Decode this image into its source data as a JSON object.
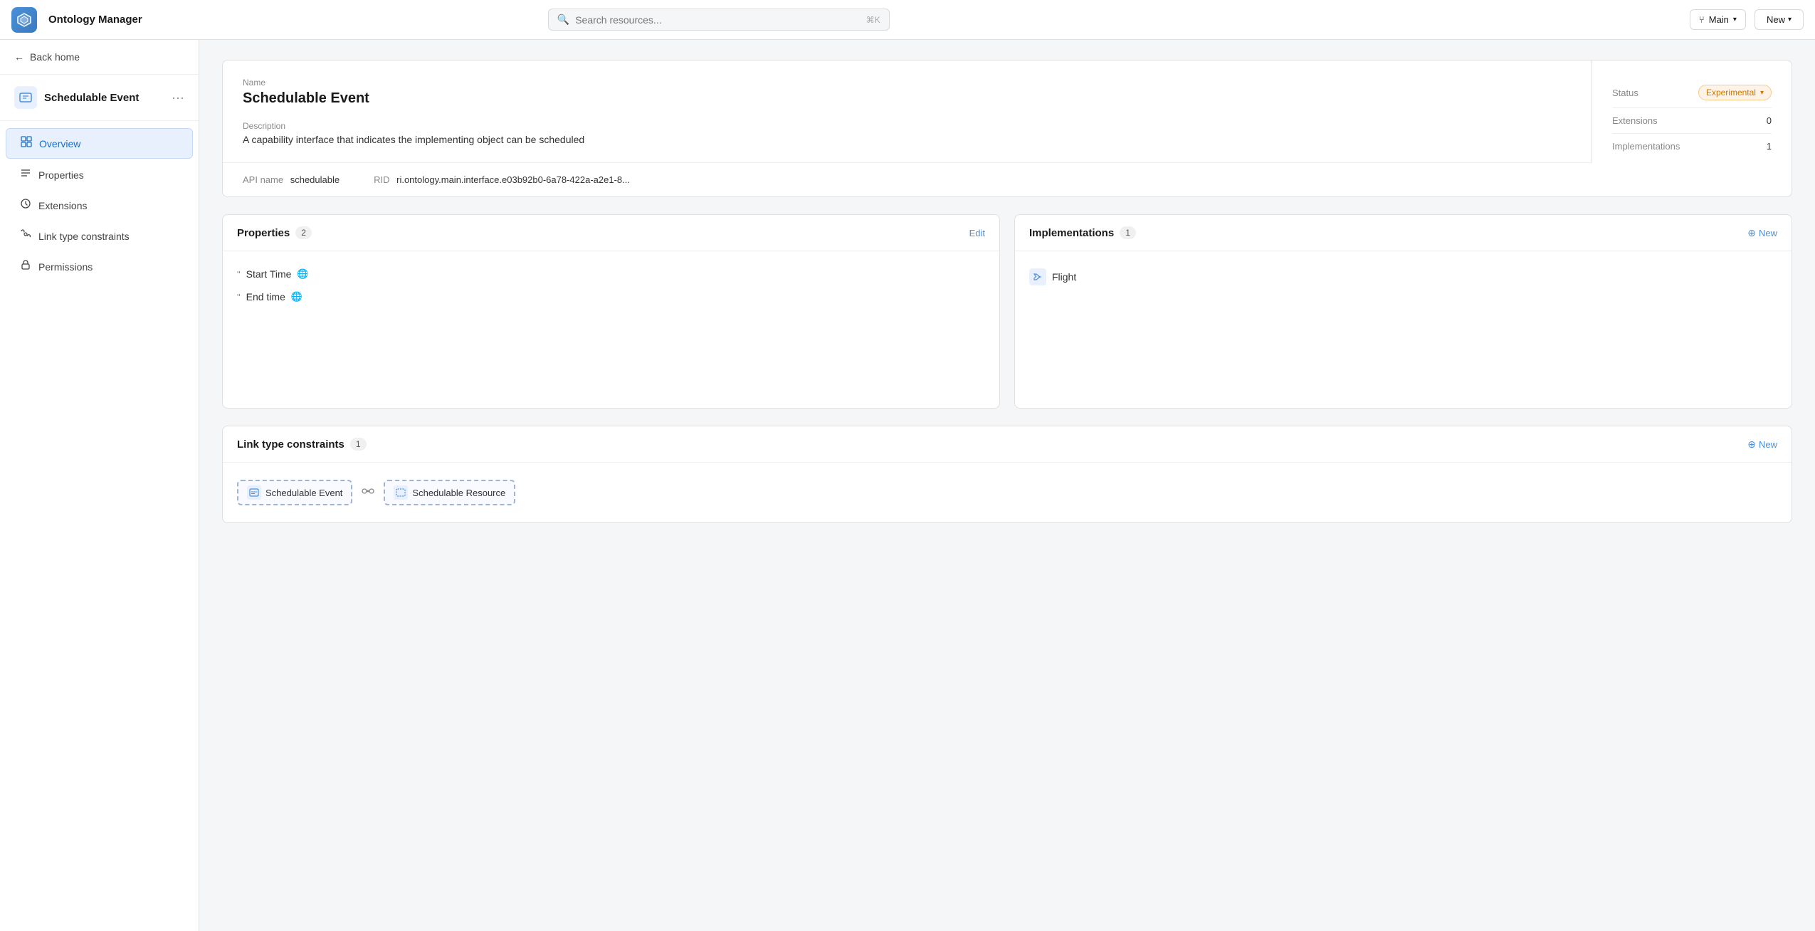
{
  "app": {
    "title": "Ontology Manager",
    "logo_glyph": "🧊"
  },
  "topbar": {
    "search_placeholder": "Search resources...",
    "search_shortcut": "⌘K",
    "branch_label": "Main",
    "new_button": "New",
    "branch_icon": "⑂"
  },
  "sidebar": {
    "back_label": "Back home",
    "entity_name": "Schedulable Event",
    "more_icon": "•••",
    "nav_items": [
      {
        "id": "overview",
        "label": "Overview",
        "icon": "▣",
        "active": true
      },
      {
        "id": "properties",
        "label": "Properties",
        "icon": "≡",
        "active": false
      },
      {
        "id": "extensions",
        "label": "Extensions",
        "icon": "⚙",
        "active": false
      },
      {
        "id": "link-type-constraints",
        "label": "Link type constraints",
        "icon": "🔗",
        "active": false
      },
      {
        "id": "permissions",
        "label": "Permissions",
        "icon": "🔒",
        "active": false
      }
    ]
  },
  "main": {
    "info_card": {
      "name_label": "Name",
      "name_value": "Schedulable Event",
      "desc_label": "Description",
      "desc_value": "A capability interface that indicates the implementing object can be scheduled",
      "api_name_label": "API name",
      "api_name_value": "schedulable",
      "rid_label": "RID",
      "rid_value": "ri.ontology.main.interface.e03b92b0-6a78-422a-a2e1-8...",
      "status_label": "Status",
      "status_value": "Experimental",
      "extensions_label": "Extensions",
      "extensions_value": "0",
      "implementations_label": "Implementations",
      "implementations_value": "1"
    },
    "properties_panel": {
      "title": "Properties",
      "count": "2",
      "action_label": "Edit",
      "items": [
        {
          "label": "Start Time",
          "has_globe": true
        },
        {
          "label": "End time",
          "has_globe": true
        }
      ]
    },
    "implementations_panel": {
      "title": "Implementations",
      "count": "1",
      "action_label": "New",
      "items": [
        {
          "label": "Flight"
        }
      ]
    },
    "ltc_panel": {
      "title": "Link type constraints",
      "count": "1",
      "action_label": "New",
      "row": {
        "source_label": "Schedulable Event",
        "target_label": "Schedulable Resource"
      }
    }
  }
}
